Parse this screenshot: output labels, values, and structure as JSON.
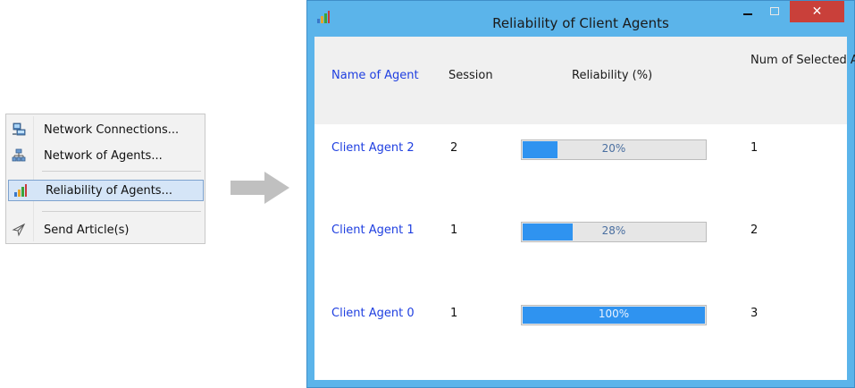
{
  "context_menu": {
    "items": [
      {
        "label": "Network Connections...",
        "icon": "network-connections-icon"
      },
      {
        "label": "Network of Agents...",
        "icon": "network-tree-icon"
      },
      {
        "label": "Reliability of Agents...",
        "icon": "bar-chart-icon",
        "selected": true
      },
      {
        "label": "Send Article(s)",
        "icon": "paper-plane-icon"
      }
    ]
  },
  "window": {
    "title": "Reliability of Client Agents",
    "close_glyph": "✕",
    "columns": {
      "name": "Name of Agent",
      "session": "Session",
      "reliability": "Reliability (%)",
      "num_articles": "Num of Selected Articles"
    },
    "rows": [
      {
        "name": "Client Agent 2",
        "session": "2",
        "reliability": 0.2,
        "reliability_label": "20%",
        "num_articles": "1"
      },
      {
        "name": "Client Agent 1",
        "session": "1",
        "reliability": 0.28,
        "reliability_label": "28%",
        "num_articles": "2"
      },
      {
        "name": "Client Agent 0",
        "session": "1",
        "reliability": 1.0,
        "reliability_label": "100%",
        "num_articles": "3"
      }
    ]
  },
  "colors": {
    "titlebar": "#5bb4ea",
    "close_button": "#c9403a",
    "progress_fill": "#2f93f0",
    "agent_name": "#1f3fe0"
  }
}
